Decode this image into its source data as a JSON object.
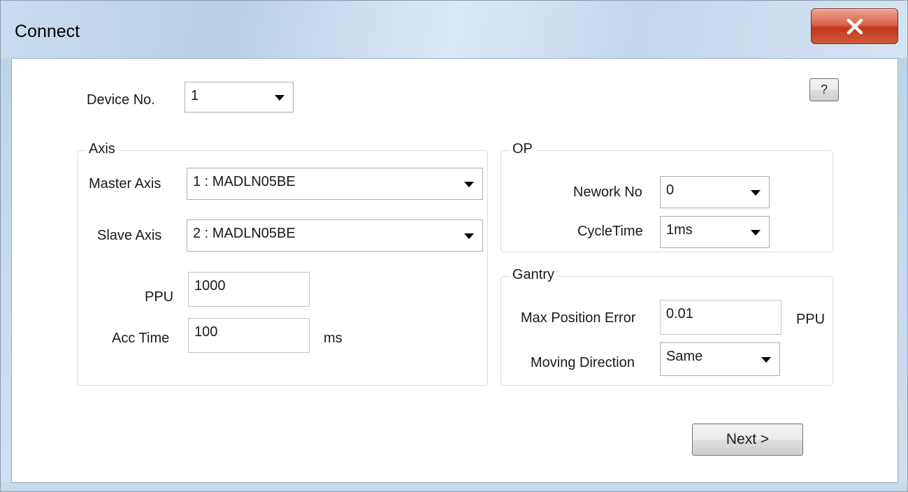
{
  "window": {
    "title": "Connect",
    "close_glyph": "X",
    "help_label": "?"
  },
  "device": {
    "label": "Device No.",
    "value": "1"
  },
  "axis": {
    "legend": "Axis",
    "master_label": "Master Axis",
    "master_value": "1 : MADLN05BE",
    "slave_label": "Slave Axis",
    "slave_value": "2 : MADLN05BE",
    "ppu_label": "PPU",
    "ppu_value": "1000",
    "acc_label": "Acc Time",
    "acc_value": "100",
    "acc_unit": "ms"
  },
  "op": {
    "legend": "OP",
    "network_label": "Nework No",
    "network_value": "0",
    "cycle_label": "CycleTime",
    "cycle_value": "1ms"
  },
  "gantry": {
    "legend": "Gantry",
    "max_error_label": "Max Position Error",
    "max_error_value": "0.01",
    "max_error_unit": "PPU",
    "direction_label": "Moving Direction",
    "direction_value": "Same"
  },
  "footer": {
    "next_label": "Next >"
  }
}
